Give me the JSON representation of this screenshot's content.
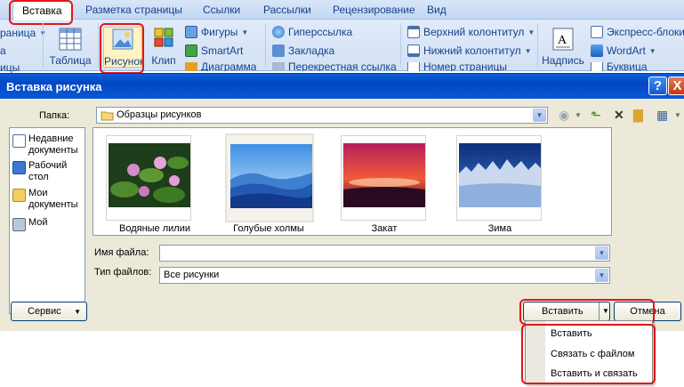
{
  "ribbon": {
    "tabs": [
      "Вставка",
      "Разметка страницы",
      "Ссылки",
      "Рассылки",
      "Рецензирование",
      "Вид"
    ],
    "left_partial": [
      "раница",
      "а",
      "ицы"
    ],
    "table_label": "Таблица",
    "picture_label": "Рисунок",
    "clip_label": "Клип",
    "shapes_label": "Фигуры",
    "smartart_label": "SmartArt",
    "diagram_label": "Диаграмма",
    "hyperlink_label": "Гиперссылка",
    "bookmark_label": "Закладка",
    "crossref_label": "Перекрестная ссылка",
    "header_label": "Верхний колонтитул",
    "footer_label": "Нижний колонтитул",
    "pagenum_label": "Номер страницы",
    "textbox_label": "Надпись",
    "quickparts_label": "Экспресс-блоки",
    "wordart_label": "WordArt",
    "dropcap_label": "Буквица"
  },
  "dialog": {
    "title": "Вставка рисунка",
    "help": "?",
    "close": "X",
    "folder_label": "Папка:",
    "folder_value": "Образцы рисунков",
    "places": [
      {
        "label": "Недавние документы"
      },
      {
        "label": "Рабочий стол"
      },
      {
        "label": "Мои документы"
      },
      {
        "label": "Мой"
      }
    ],
    "files": [
      {
        "name": "Водяные лилии"
      },
      {
        "name": "Голубые холмы"
      },
      {
        "name": "Закат"
      },
      {
        "name": "Зима"
      }
    ],
    "filename_label": "Имя файла:",
    "filename_value": "",
    "filetype_label": "Тип файлов:",
    "filetype_value": "Все рисунки",
    "service_button": "Сервис",
    "insert_button": "Вставить",
    "cancel_button": "Отмена"
  },
  "insert_menu": {
    "items": [
      "Вставить",
      "Связать с файлом",
      "Вставить и связать"
    ]
  },
  "colors": {
    "highlight_red": "#e3151a",
    "titlebar_blue": "#0346c4",
    "ribbon_text": "#15428b"
  },
  "icons": {
    "toolbar": [
      "back-icon",
      "up-folder-icon",
      "delete-icon",
      "new-folder-icon",
      "views-icon"
    ]
  }
}
